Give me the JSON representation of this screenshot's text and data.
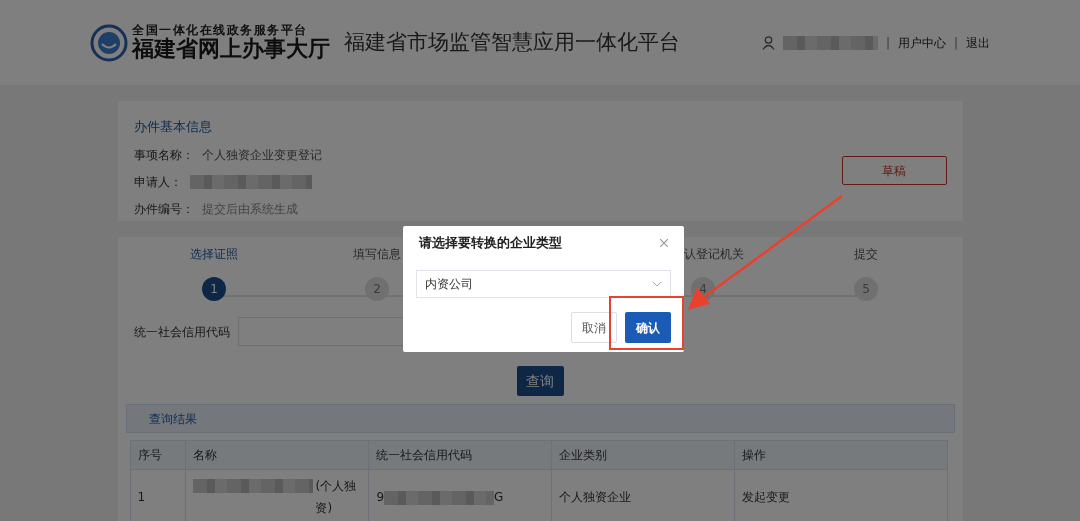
{
  "header": {
    "portal_subtitle": "全国一体化在线政务服务平台",
    "portal_title": "福建省网上办事大厅",
    "platform_title": "福建省市场监管智慧应用一体化平台",
    "user_redacted": true,
    "user_links": [
      {
        "separator": "|",
        "label": "用户中心"
      },
      {
        "separator": "|",
        "label": "退出"
      }
    ]
  },
  "basic_info": {
    "title": "办件基本信息",
    "fields": [
      {
        "label": "事项名称：",
        "value": "个人独资企业变更登记",
        "redacted": false
      },
      {
        "label": "申请人：",
        "redacted": true
      },
      {
        "label": "办件编号：",
        "value": "提交后由系统生成",
        "redacted": false
      }
    ],
    "draft_button": "草稿"
  },
  "steps": [
    {
      "number": "1",
      "label": "选择证照",
      "selected": true
    },
    {
      "number": "2",
      "label": "填写信息",
      "selected": false
    },
    {
      "number": "4",
      "label": "认登记机关",
      "selected": false
    },
    {
      "number": "5",
      "label": "提交",
      "selected": false
    }
  ],
  "search": {
    "label": "统一社会信用代码",
    "button": "查询"
  },
  "results": {
    "title": "查询结果",
    "columns": [
      "序号",
      "名称",
      "统一社会信用代码",
      "企业类别",
      "操作"
    ],
    "rows": [
      {
        "index": "1",
        "name_redacted": true,
        "name_suffix": "(个人独资)",
        "code_prefix": "9",
        "code_redacted": true,
        "code_suffix": "G",
        "category": "个人独资企业",
        "action": "发起变更"
      }
    ]
  },
  "dialog": {
    "title": "请选择要转换的企业类型",
    "select_value": "内资公司",
    "cancel": "取消",
    "confirm": "确认",
    "confirm_highlighted": true
  }
}
